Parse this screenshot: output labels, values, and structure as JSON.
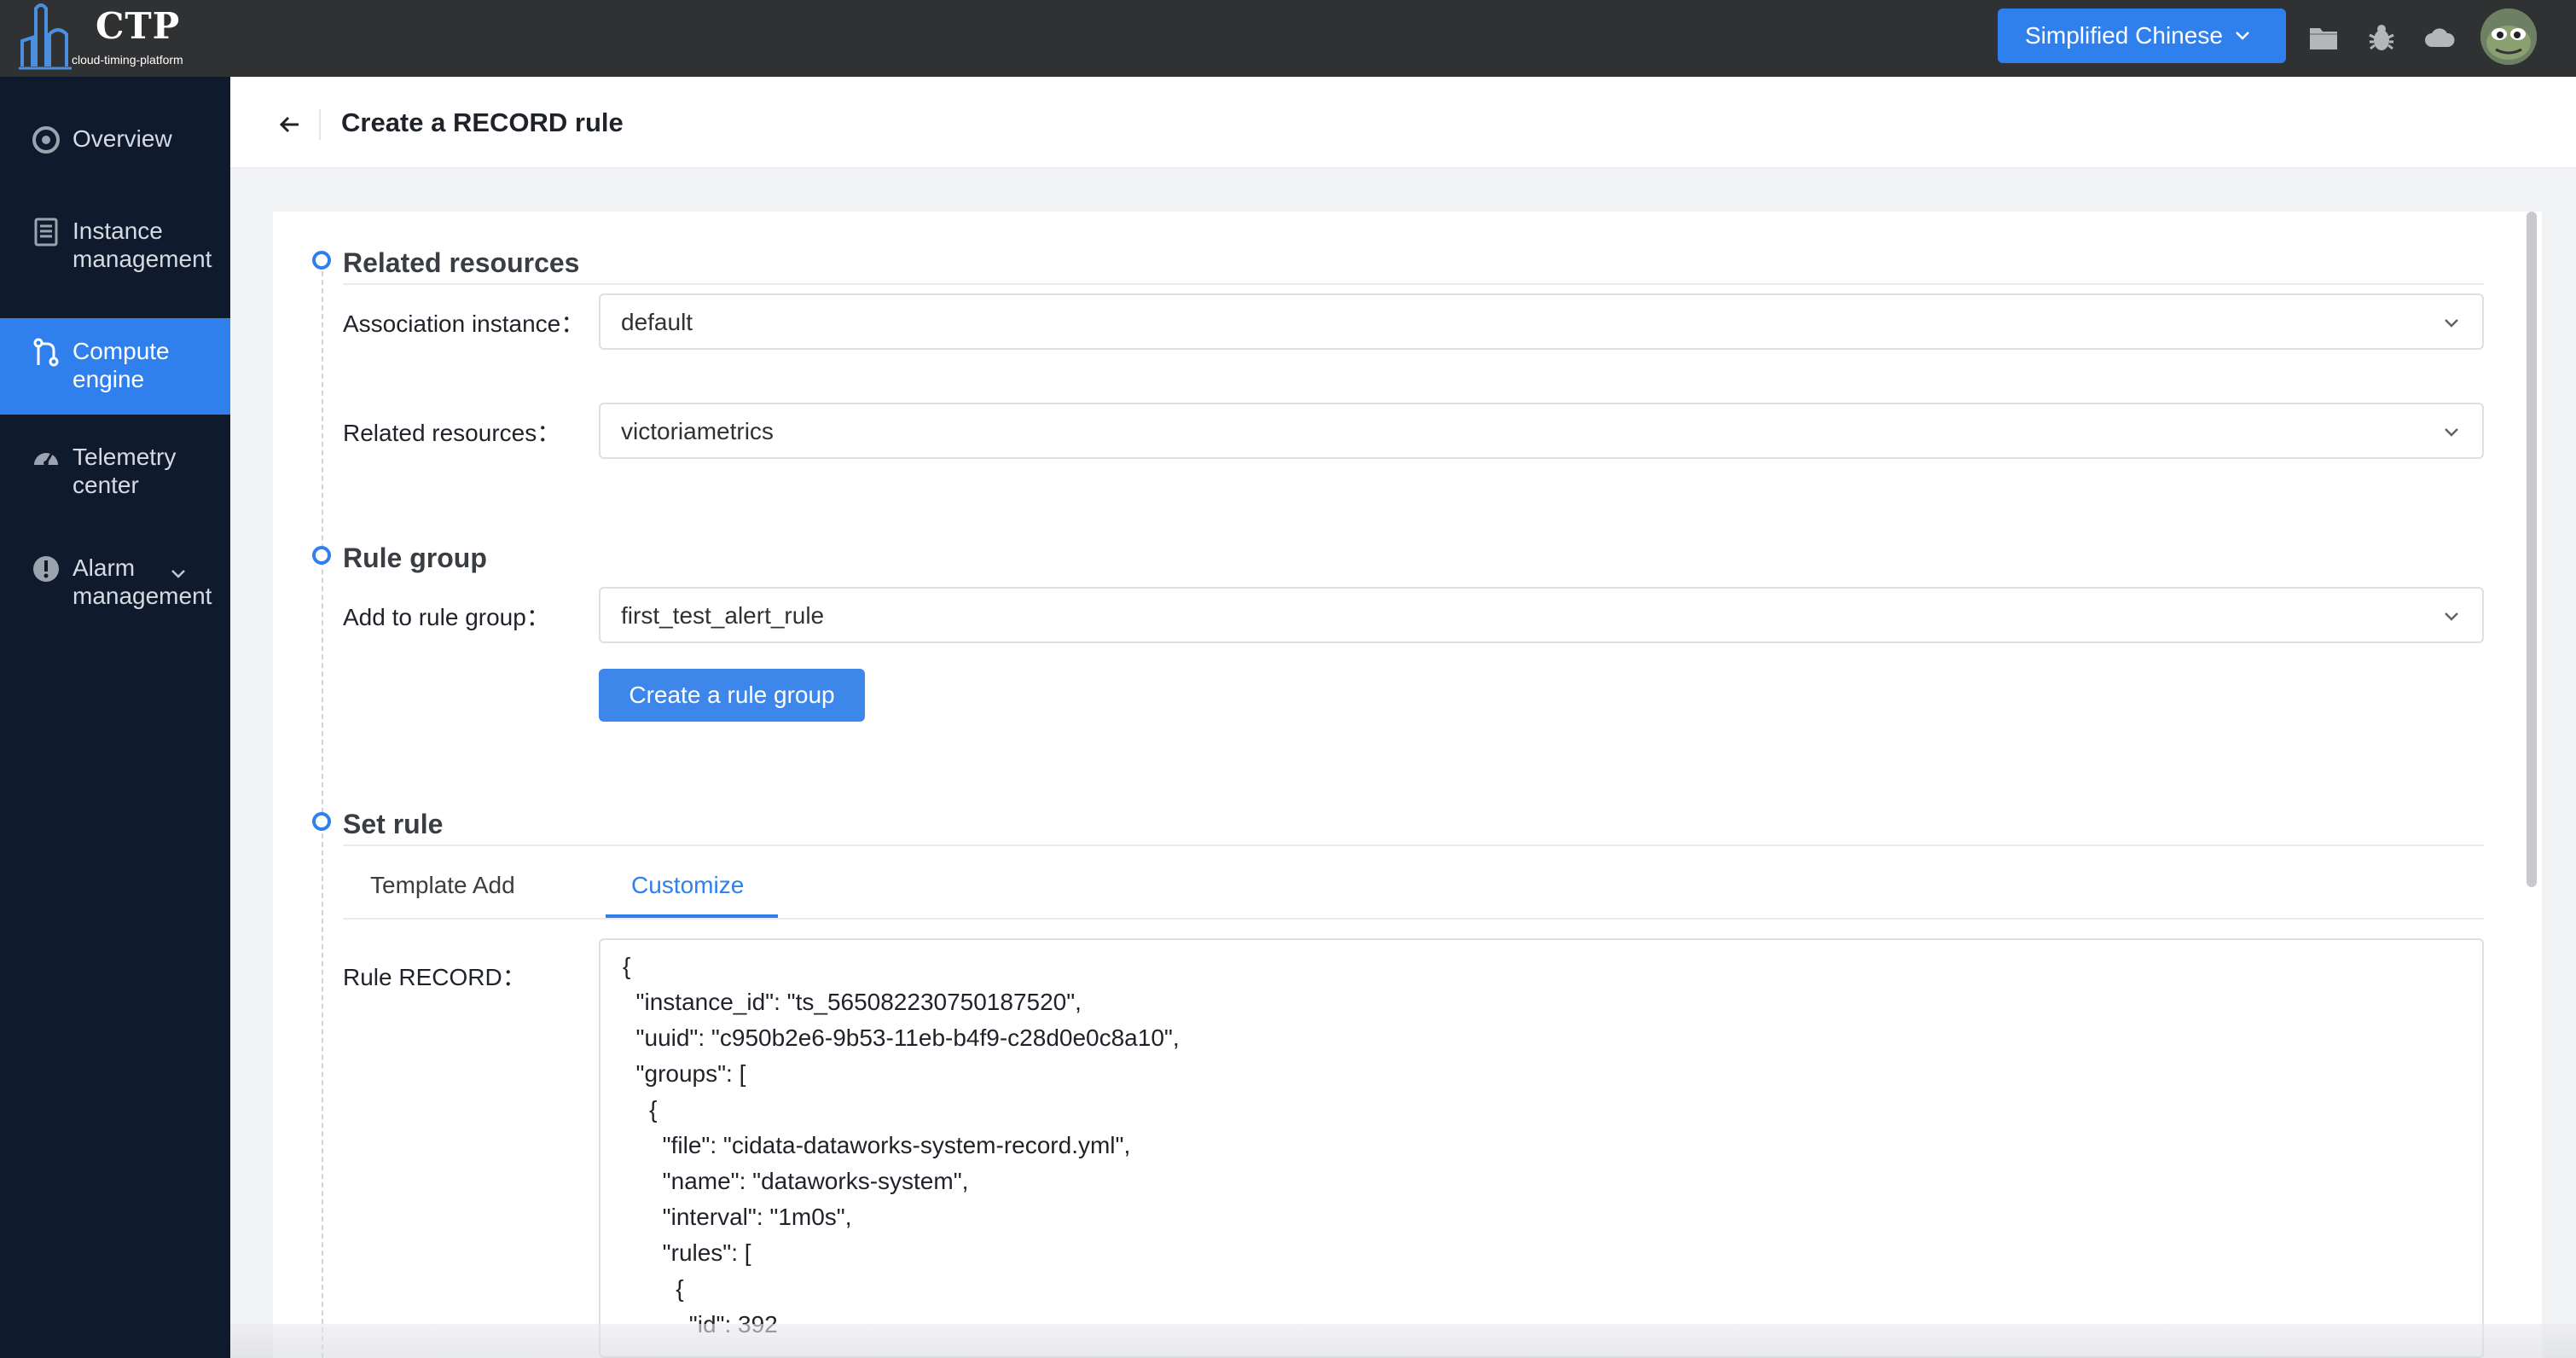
{
  "header": {
    "logo_title": "CTP",
    "logo_subtitle": "cloud-timing-platform",
    "language_button": "Simplified Chinese",
    "icons": [
      "folder-icon",
      "bug-icon",
      "cloud-icon",
      "user-avatar"
    ]
  },
  "sidebar": {
    "items": [
      {
        "label": "Overview",
        "icon": "target-icon",
        "active": false
      },
      {
        "label": "Instance\nmanagement",
        "icon": "document-list-icon",
        "active": false
      },
      {
        "label": "Compute\nengine",
        "icon": "compute-branch-icon",
        "active": true
      },
      {
        "label": "Telemetry\ncenter",
        "icon": "dashboard-gauge-icon",
        "active": false
      },
      {
        "label": "Alarm\nmanagement",
        "icon": "alert-icon",
        "active": false,
        "expandable": true
      }
    ]
  },
  "page": {
    "title": "Create a RECORD rule"
  },
  "sections": {
    "related": {
      "title": "Related resources",
      "association_label": "Association instance：",
      "association_value": "default",
      "resources_label": "Related resources：",
      "resources_value": "victoriametrics"
    },
    "group": {
      "title": "Rule group",
      "add_label": "Add to rule group：",
      "add_value": "first_test_alert_rule",
      "create_button": "Create a rule group"
    },
    "rule": {
      "title": "Set rule",
      "tabs": [
        {
          "label": "Template Add",
          "active": false
        },
        {
          "label": "Customize",
          "active": true
        }
      ],
      "record_label": "Rule RECORD：",
      "code": "{\n  \"instance_id\": \"ts_565082230750187520\",\n  \"uuid\": \"c950b2e6-9b53-11eb-b4f9-c28d0e0c8a10\",\n  \"groups\": [\n    {\n      \"file\": \"cidata-dataworks-system-record.yml\",\n      \"name\": \"dataworks-system\",\n      \"interval\": \"1m0s\",\n      \"rules\": [\n        {\n          \"id\": 392"
    }
  },
  "colors": {
    "accent": "#2f80ed",
    "sidebar_bg": "#0f1b2d",
    "topbar_bg": "#303133"
  }
}
